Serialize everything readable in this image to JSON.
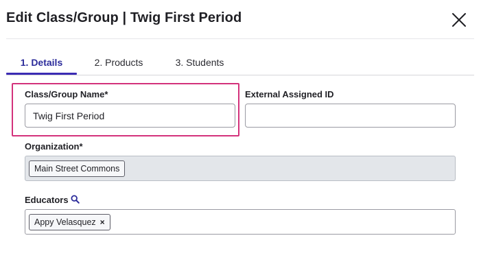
{
  "dialog": {
    "title": "Edit Class/Group | Twig First Period",
    "close_icon": "close-icon"
  },
  "tabs": [
    {
      "label": "1. Details",
      "active": true
    },
    {
      "label": "2. Products",
      "active": false
    },
    {
      "label": "3. Students",
      "active": false
    }
  ],
  "form": {
    "class_name": {
      "label": "Class/Group Name*",
      "value": "Twig First Period"
    },
    "external_id": {
      "label": "External Assigned ID",
      "value": ""
    },
    "organization": {
      "label": "Organization*",
      "chips": [
        "Main Street Commons"
      ]
    },
    "educators": {
      "label": "Educators",
      "icon": "search-icon",
      "chips": [
        "Appy Velasquez"
      ],
      "remove_glyph": "×"
    }
  },
  "colors": {
    "accent": "#3b2bb4",
    "active_tab_text": "#2b2b9a",
    "highlight": "#d3317b",
    "readonly_bg": "#e3e6ea"
  }
}
